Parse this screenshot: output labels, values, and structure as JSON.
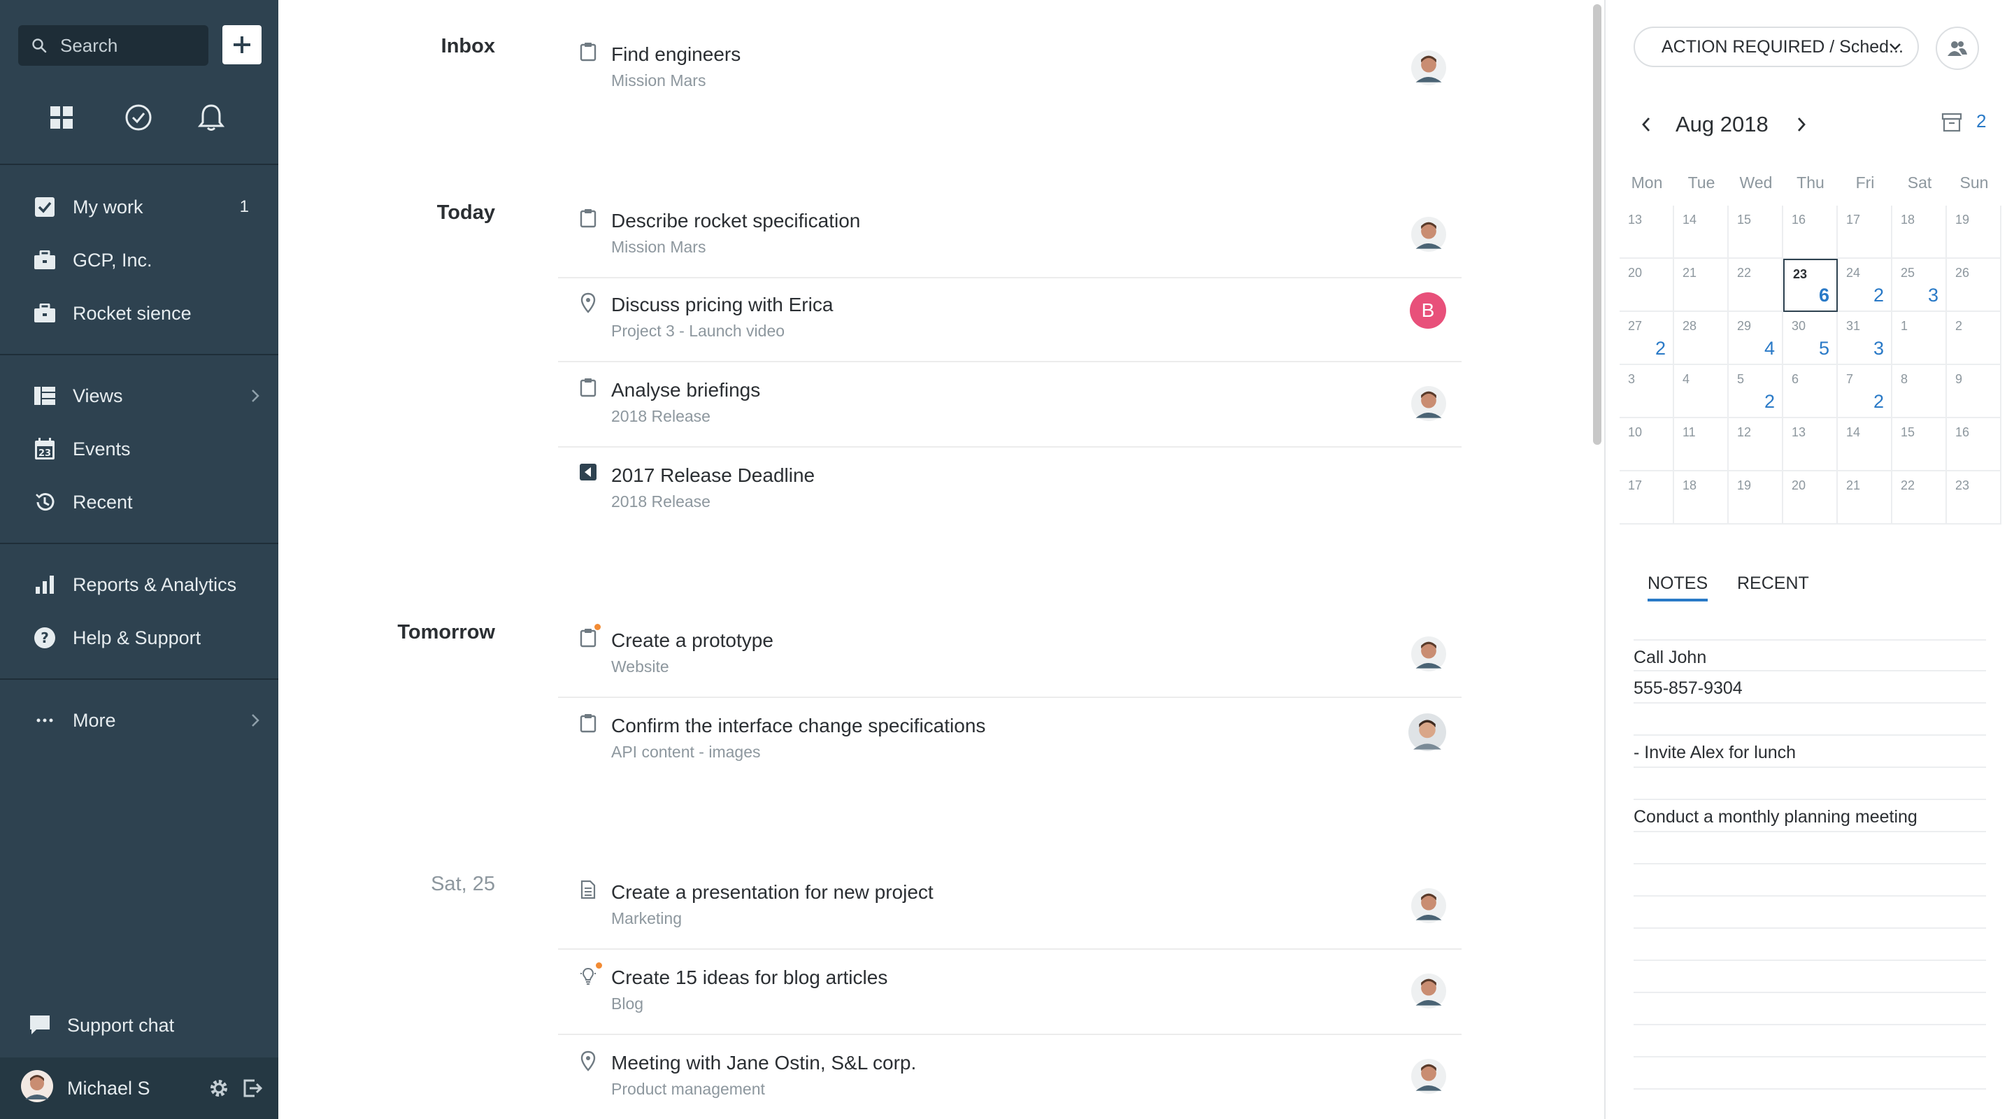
{
  "sidebar": {
    "search_placeholder": "Search",
    "top_icons": [
      "grid-icon",
      "clock-icon",
      "bell-icon"
    ],
    "items": [
      {
        "label": "My work",
        "icon": "checkbox-icon",
        "count": "1"
      },
      {
        "label": "GCP, Inc.",
        "icon": "briefcase-icon"
      },
      {
        "label": "Rocket sience",
        "icon": "briefcase-icon"
      },
      {
        "label": "Views",
        "icon": "views-icon"
      },
      {
        "label": "Events",
        "icon": "calendar-icon"
      },
      {
        "label": "Recent",
        "icon": "history-icon"
      },
      {
        "label": "Reports & Analytics",
        "icon": "bar-chart-icon"
      },
      {
        "label": "Help & Support",
        "icon": "question-icon"
      },
      {
        "label": "More",
        "icon": "ellipsis-icon"
      }
    ],
    "support_chat": "Support chat",
    "user_name": "Michael S"
  },
  "sections": [
    {
      "label": "Inbox",
      "tasks": [
        {
          "title": "Find engineers",
          "subtitle": "Mission Mars",
          "icon": "clipboard-icon"
        }
      ]
    },
    {
      "label": "Today",
      "tasks": [
        {
          "title": "Describe rocket specification",
          "subtitle": "Mission Mars",
          "icon": "clipboard-icon"
        },
        {
          "title": "Discuss pricing with Erica",
          "subtitle": "Project 3 - Launch video",
          "icon": "pin-icon",
          "avatar_letter": "B"
        },
        {
          "title": "Analyse briefings",
          "subtitle": "2018 Release",
          "icon": "clipboard-icon"
        },
        {
          "title": "2017 Release Deadline",
          "subtitle": "2018 Release",
          "icon": "deadline-icon"
        }
      ]
    },
    {
      "label": "Tomorrow",
      "tasks": [
        {
          "title": "Create a prototype",
          "subtitle": "Website",
          "icon": "clipboard-icon"
        },
        {
          "title": "Confirm the interface change specifications",
          "subtitle": "API content - images",
          "icon": "clipboard-icon"
        }
      ]
    },
    {
      "label": "Sat, 25",
      "tasks": [
        {
          "title": "Create a presentation for new project",
          "subtitle": "Marketing",
          "icon": "document-icon"
        },
        {
          "title": "Create 15 ideas for blog articles",
          "subtitle": "Blog",
          "icon": "lightbulb-icon"
        },
        {
          "title": "Meeting with Jane Ostin, S&L corp.",
          "subtitle": "Product management",
          "icon": "pin-icon"
        }
      ]
    }
  ],
  "right_panel": {
    "filter_label": "ACTION REQUIRED / Sched...",
    "calendar": {
      "month_label": "Aug 2018",
      "header_count": "2",
      "weekdays": [
        "Mon",
        "Tue",
        "Wed",
        "Thu",
        "Fri",
        "Sat",
        "Sun"
      ],
      "weeks": [
        [
          {
            "d": "13"
          },
          {
            "d": "14"
          },
          {
            "d": "15"
          },
          {
            "d": "16"
          },
          {
            "d": "17"
          },
          {
            "d": "18"
          },
          {
            "d": "19"
          }
        ],
        [
          {
            "d": "20"
          },
          {
            "d": "21"
          },
          {
            "d": "22"
          },
          {
            "d": "23",
            "c": "6",
            "today": true
          },
          {
            "d": "24",
            "c": "2"
          },
          {
            "d": "25",
            "c": "3"
          },
          {
            "d": "26"
          }
        ],
        [
          {
            "d": "27",
            "c": "2"
          },
          {
            "d": "28"
          },
          {
            "d": "29",
            "c": "4"
          },
          {
            "d": "30",
            "c": "5"
          },
          {
            "d": "31",
            "c": "3"
          },
          {
            "d": "1"
          },
          {
            "d": "2"
          }
        ],
        [
          {
            "d": "3"
          },
          {
            "d": "4"
          },
          {
            "d": "5",
            "c": "2"
          },
          {
            "d": "6"
          },
          {
            "d": "7",
            "c": "2"
          },
          {
            "d": "8"
          },
          {
            "d": "9"
          }
        ],
        [
          {
            "d": "10"
          },
          {
            "d": "11"
          },
          {
            "d": "12"
          },
          {
            "d": "13"
          },
          {
            "d": "14"
          },
          {
            "d": "15"
          },
          {
            "d": "16"
          }
        ],
        [
          {
            "d": "17"
          },
          {
            "d": "18"
          },
          {
            "d": "19"
          },
          {
            "d": "20"
          },
          {
            "d": "21"
          },
          {
            "d": "22"
          },
          {
            "d": "23"
          }
        ]
      ]
    },
    "tabs": [
      "NOTES",
      "RECENT"
    ],
    "notes": [
      "Call John",
      "555-857-9304",
      "",
      "- Invite Alex for lunch",
      "",
      "Conduct a monthly planning meeting",
      "",
      "",
      "",
      "",
      "",
      "",
      "",
      ""
    ]
  },
  "colors": {
    "sidebar_bg": "#2e4250",
    "accent": "#2a7ac7",
    "avatar_pink": "#e8507a",
    "notification_dot": "#f28b34"
  }
}
